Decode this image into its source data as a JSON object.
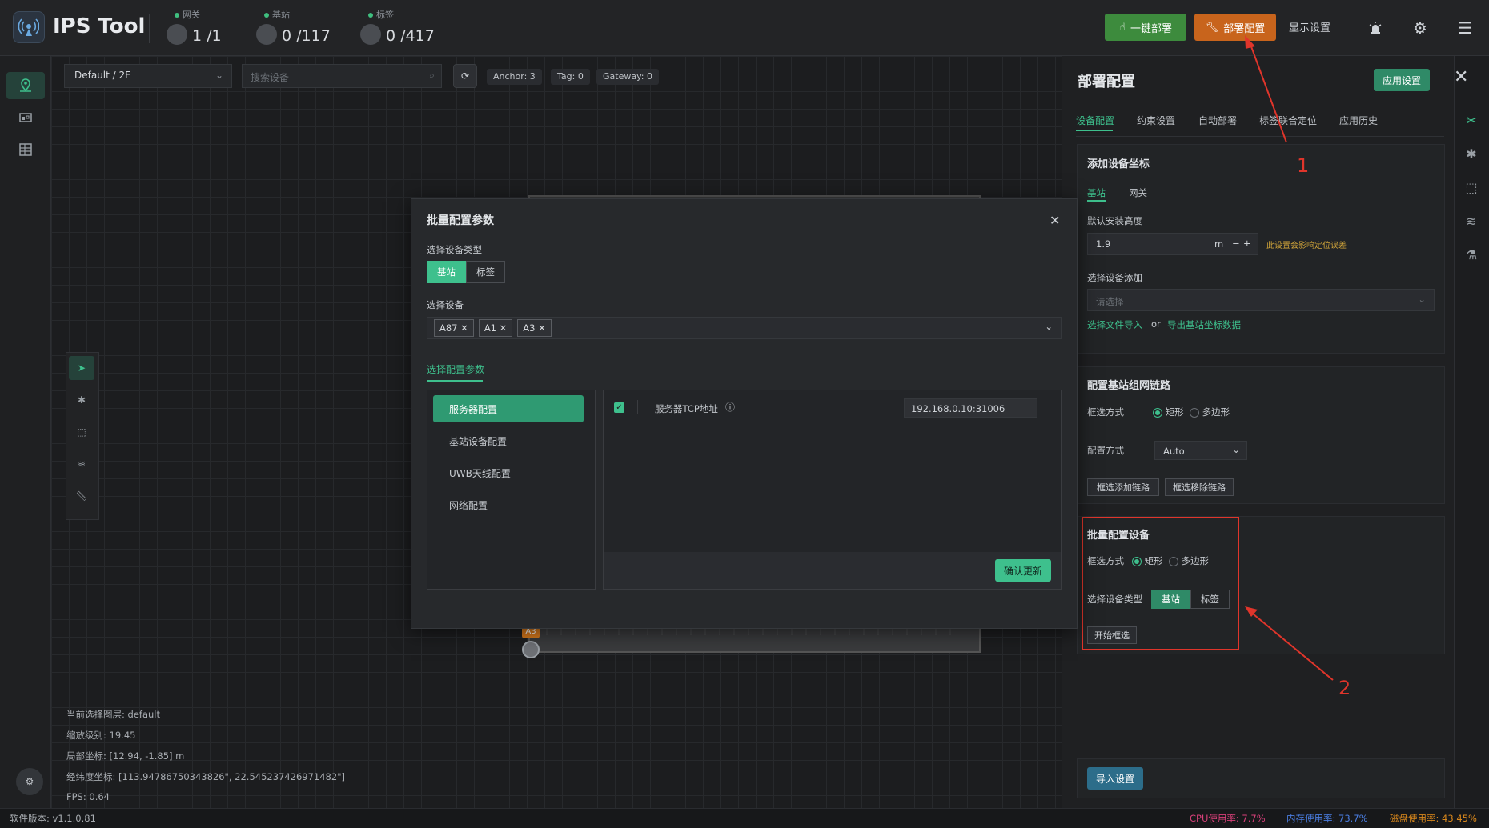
{
  "app": {
    "title": "IPS Tool"
  },
  "stats": [
    {
      "label": "网关",
      "value": "1 /1"
    },
    {
      "label": "基站",
      "value": "0 /117"
    },
    {
      "label": "标签",
      "value": "0 /417"
    }
  ],
  "top_actions": {
    "deploy_one": "一键部署",
    "deploy_config": "部署配置",
    "display_settings": "显示设置"
  },
  "map": {
    "floor": "Default / 2F",
    "search_placeholder": "搜索设备",
    "pills": {
      "anchor": "Anchor: 3",
      "tag": "Tag: 0",
      "gateway": "Gateway: 0"
    },
    "marker_label": "A3",
    "info": {
      "layer": "当前选择图层:  default",
      "zoom": "缩放级别:  19.45",
      "local": "局部坐标:  [12.94, -1.85] m",
      "latlng": "经纬度坐标:  [113.94786750343826\", 22.545237426971482\"]",
      "fps": "FPS:  0.64"
    }
  },
  "status": {
    "version": "软件版本: v1.1.0.81",
    "cpu_label": "CPU使用率:",
    "cpu": "7.7%",
    "mem_label": "内存使用率:",
    "mem": "73.7%",
    "disk_label": "磁盘使用率:",
    "disk": "43.45%"
  },
  "panel": {
    "title": "部署配置",
    "apply": "应用设置",
    "tabs": [
      "设备配置",
      "约束设置",
      "自动部署",
      "标签联合定位",
      "应用历史"
    ],
    "add_coords": {
      "title": "添加设备坐标",
      "subtabs": [
        "基站",
        "网关"
      ],
      "height_label": "默认安装高度",
      "height_value": "1.9",
      "unit": "m",
      "warn": "此设置会影响定位误差",
      "select_label": "选择设备添加",
      "select_placeholder": "请选择",
      "file_import": "选择文件导入",
      "or": "or",
      "export": "导出基站坐标数据"
    },
    "link": {
      "title": "配置基站组网链路",
      "select_mode_label": "框选方式",
      "rect": "矩形",
      "polygon": "多边形",
      "config_mode_label": "配置方式",
      "config_mode_value": "Auto",
      "add_link": "框选添加链路",
      "remove_link": "框选移除链路"
    },
    "batch": {
      "title": "批量配置设备",
      "select_mode_label": "框选方式",
      "rect": "矩形",
      "polygon": "多边形",
      "type_label": "选择设备类型",
      "types": [
        "基站",
        "标签"
      ],
      "start": "开始框选"
    },
    "import": "导入设置"
  },
  "annotations": {
    "one": "1",
    "two": "2"
  },
  "modal": {
    "title": "批量配置参数",
    "type_label": "选择设备类型",
    "types": [
      "基站",
      "标签"
    ],
    "device_label": "选择设备",
    "devices": [
      "A87",
      "A1",
      "A3"
    ],
    "params_tab": "选择配置参数",
    "items": [
      "服务器配置",
      "基站设备配置",
      "UWB天线配置",
      "网络配置"
    ],
    "row_label": "服务器TCP地址",
    "row_value": "192.168.0.10:31006",
    "confirm": "确认更新"
  }
}
